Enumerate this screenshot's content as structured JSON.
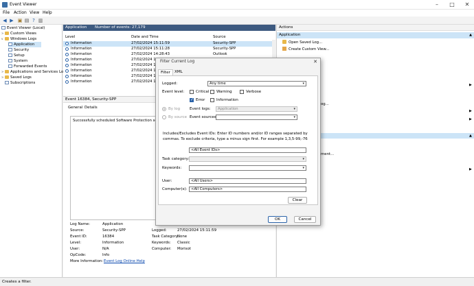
{
  "window": {
    "title": "Event Viewer"
  },
  "menu": [
    "File",
    "Action",
    "View",
    "Help"
  ],
  "tree": [
    {
      "label": "Event Viewer (Local)",
      "indent": 0,
      "kind": "root"
    },
    {
      "label": "Custom Views",
      "indent": 1,
      "kind": "folder"
    },
    {
      "label": "Windows Logs",
      "indent": 1,
      "kind": "folder"
    },
    {
      "label": "Application",
      "indent": 2,
      "kind": "log",
      "selected": true
    },
    {
      "label": "Security",
      "indent": 2,
      "kind": "log"
    },
    {
      "label": "Setup",
      "indent": 2,
      "kind": "log"
    },
    {
      "label": "System",
      "indent": 2,
      "kind": "log"
    },
    {
      "label": "Forwarded Events",
      "indent": 2,
      "kind": "log"
    },
    {
      "label": "Applications and Services Lo",
      "indent": 1,
      "kind": "folder"
    },
    {
      "label": "Saved Logs",
      "indent": 1,
      "kind": "folder"
    },
    {
      "label": "Subscriptions",
      "indent": 1,
      "kind": "log"
    }
  ],
  "center": {
    "header_title": "Application",
    "header_count": "Number of events: 27,179",
    "columns": [
      "Level",
      "Date and Time",
      "Source"
    ],
    "rows": [
      {
        "level": "Information",
        "date": "27/02/2024 15:11:59",
        "source": "Security-SPP"
      },
      {
        "level": "Information",
        "date": "27/02/2024 15:11:28",
        "source": "Security-SPP"
      },
      {
        "level": "Information",
        "date": "27/02/2024 14:28:43",
        "source": "Outlook"
      },
      {
        "level": "Information",
        "date": "27/02/2024 14",
        "source": ""
      },
      {
        "level": "Information",
        "date": "27/02/2024 14",
        "source": ""
      },
      {
        "level": "Information",
        "date": "27/02/2024 14",
        "source": ""
      },
      {
        "level": "Information",
        "date": "27/02/2024 14",
        "source": ""
      },
      {
        "level": "Information",
        "date": "27/02/2024 14",
        "source": ""
      }
    ]
  },
  "detail": {
    "header": "Event 16384, Security-SPP",
    "tabs": [
      "General",
      "Details"
    ],
    "message": "Successfully scheduled Software Protection service",
    "fields_left": [
      {
        "k": "Log Name:",
        "v": "Application"
      },
      {
        "k": "Source:",
        "v": "Security-SPP"
      },
      {
        "k": "Event ID:",
        "v": "16384"
      },
      {
        "k": "Level:",
        "v": "Information"
      },
      {
        "k": "User:",
        "v": "N/A"
      },
      {
        "k": "OpCode:",
        "v": "Info"
      },
      {
        "k": "More Information:",
        "v": "Event Log Online Help"
      }
    ],
    "fields_right": [
      {
        "k": "Logged:",
        "v": "27/02/2024 15:11:59"
      },
      {
        "k": "Task Category:",
        "v": "None"
      },
      {
        "k": "Keywords:",
        "v": "Classic"
      },
      {
        "k": "Computer:",
        "v": "Morisot"
      }
    ]
  },
  "actions": {
    "header": "Actions",
    "section": "Application",
    "items": [
      "Open Saved Log...",
      "Create Custom View..."
    ],
    "partial_items": [
      "og...",
      "ment..."
    ]
  },
  "status": "Creates a filter.",
  "dialog": {
    "title": "Filter Current Log",
    "tabs": [
      "Filter",
      "XML"
    ],
    "logged_label": "Logged:",
    "logged_value": "Any time",
    "event_level_label": "Event level:",
    "levels": [
      {
        "label": "Critical",
        "checked": false
      },
      {
        "label": "Warning",
        "checked": false
      },
      {
        "label": "Verbose",
        "checked": false
      },
      {
        "label": "Error",
        "checked": true
      },
      {
        "label": "Information",
        "checked": false
      }
    ],
    "by_log": "By log",
    "by_source": "By source",
    "event_logs_label": "Event logs:",
    "event_logs_value": "Application",
    "event_sources_label": "Event sources:",
    "description": "Includes/Excludes Event IDs: Enter ID numbers and/or ID ranges separated by commas. To exclude criteria, type a minus sign first. For example 1,3,5-99,-76",
    "event_ids_value": "<All Event IDs>",
    "task_category_label": "Task category:",
    "keywords_label": "Keywords:",
    "user_label": "User:",
    "user_value": "<All Users>",
    "computer_label": "Computer(s):",
    "computer_value": "<All Computers>",
    "clear_label": "Clear",
    "ok_label": "OK",
    "cancel_label": "Cancel"
  }
}
